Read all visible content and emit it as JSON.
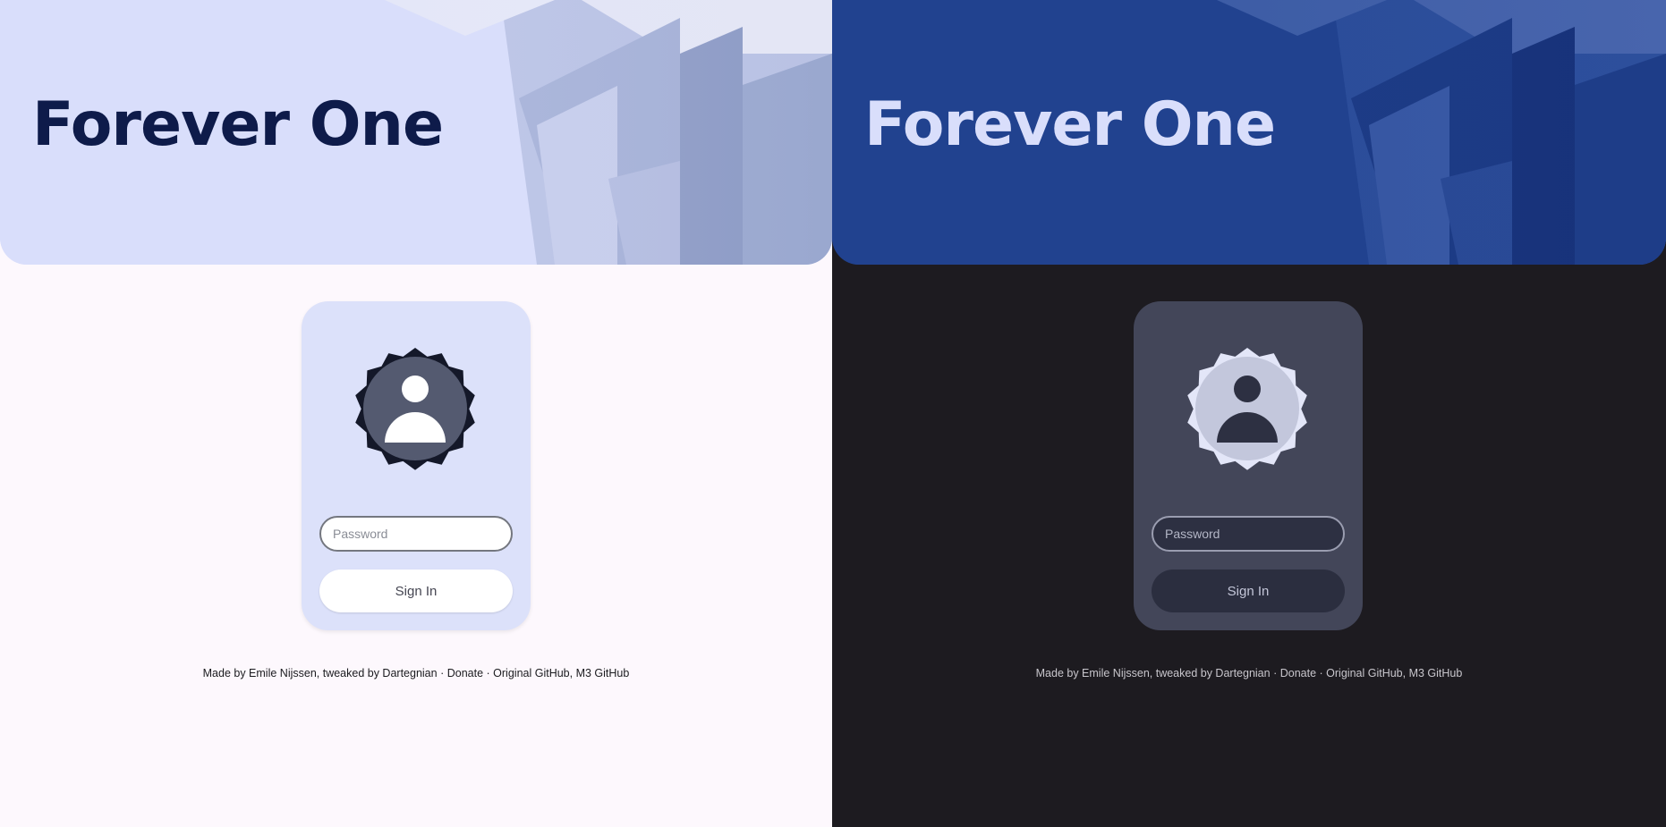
{
  "app": {
    "title": "Forever One",
    "password_placeholder": "Password",
    "signin_label": "Sign In",
    "footer": {
      "made_by_text": "Made by Emile Nijssen, tweaked by Dartegnian",
      "separator": "·",
      "donate_label": "Donate",
      "original_github_label": "Original GitHub,",
      "m3_github_label": "M3 GitHub"
    }
  },
  "themes": {
    "light": {
      "background": "#fdf8fd",
      "hero": "#d9defb",
      "title": "#0e1b4a",
      "card": "#dce1fa",
      "avatar_ring": "#141829",
      "avatar_fill": "#545a70"
    },
    "dark": {
      "background": "#1d1b20",
      "hero": "#21428f",
      "title": "#d9defb",
      "card": "#434659",
      "avatar_ring": "#e3e6f8",
      "avatar_fill": "#c3c7dc"
    }
  },
  "icons": {
    "avatar": "user-badge-icon"
  }
}
